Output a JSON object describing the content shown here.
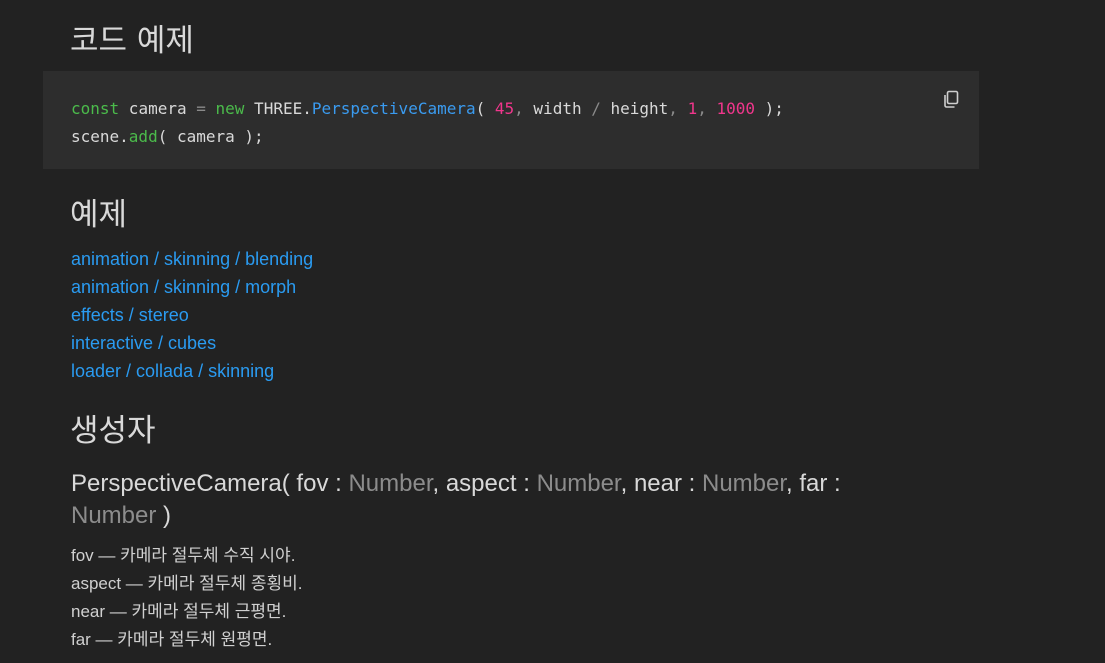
{
  "sections": {
    "code_example_title": "코드 예제",
    "examples_title": "예제",
    "constructor_title": "생성자"
  },
  "code": {
    "line1": {
      "kw": "const",
      "var": " camera ",
      "eq": "=",
      "new": "new",
      "three": " THREE.",
      "cls": "PerspectiveCamera",
      "open": "( ",
      "n45": "45",
      "c1": ", ",
      "width": "width ",
      "slash": "/",
      "height": " height",
      "c2": ", ",
      "n1": "1",
      "c3": ", ",
      "n1000": "1000",
      "close": " );"
    },
    "line2": {
      "obj": "scene.",
      "fn": "add",
      "args": "( camera );"
    },
    "copy_icon": "copy-icon"
  },
  "examples": [
    "animation / skinning / blending",
    "animation / skinning / morph",
    "effects / stereo",
    "interactive / cubes",
    "loader / collada / skinning"
  ],
  "constructor": {
    "name": "PerspectiveCamera( ",
    "p1": "fov : ",
    "t1": "Number",
    "sep1": ", aspect : ",
    "t2": "Number",
    "sep2": ", near : ",
    "t3": "Number",
    "sep3": ", far : ",
    "t4": "Number",
    "end": " )"
  },
  "params": [
    "fov — 카메라 절두체 수직 시야.",
    "aspect — 카메라 절두체 종횡비.",
    "near — 카메라 절두체 근평면.",
    "far — 카메라 절두체 원평면."
  ],
  "colors": {
    "background": "#222222",
    "code_background": "#2d2d2d",
    "link": "#2a9bf1",
    "keyword": "#4bbb4b",
    "class": "#3a9bf0",
    "number": "#f0368c"
  }
}
